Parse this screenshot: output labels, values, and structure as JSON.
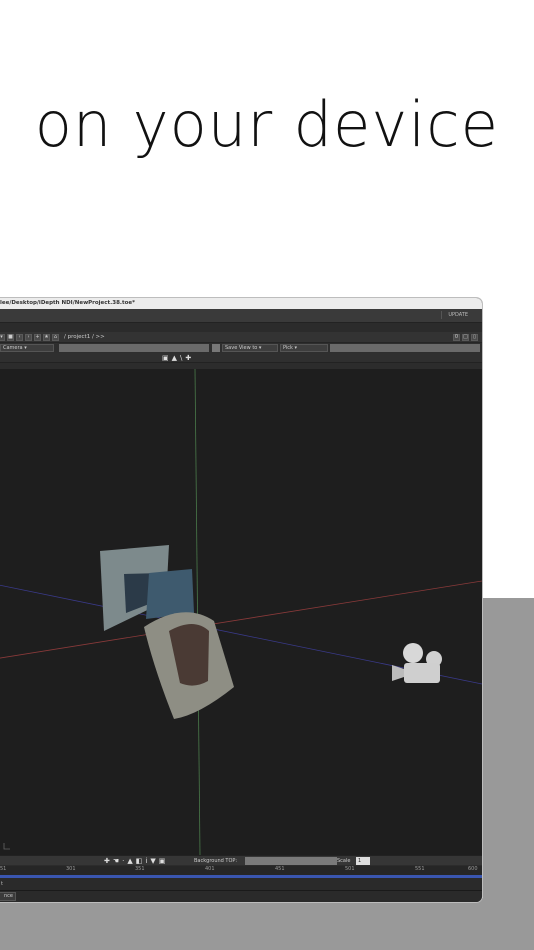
{
  "headline": "on your device",
  "window": {
    "title": "lee/Desktop/iDepth NDI/NewProject.38.toe*",
    "update_label": "UPDATE",
    "path": "/ project1 / >>",
    "camera_select": "Camera",
    "save_view": "Save View to",
    "pick": "Pick",
    "background_label": "Background TOP:",
    "scale_label": "Scale",
    "scale_value": "1",
    "timeline_ticks": [
      "51",
      "301",
      "351",
      "401",
      "451",
      "501",
      "551",
      "600"
    ],
    "status_line": "t",
    "status_label": "nce"
  },
  "colors": {
    "viewport_bg": "#1e1e1e",
    "axis_green": "#4a7a4a",
    "axis_red": "#8a3a3a",
    "axis_blue": "#3a3a8a",
    "timeline_blue": "#3a56b0",
    "grey_block": "#999999"
  }
}
